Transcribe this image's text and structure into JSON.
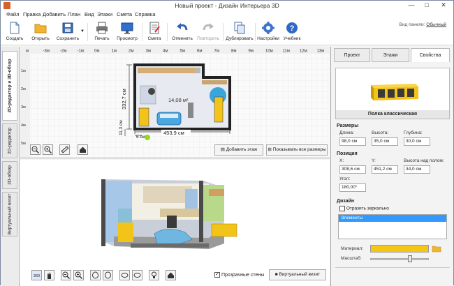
{
  "window": {
    "title": "Новый проект - Дизайн Интерьера 3D",
    "min": "—",
    "max": "□",
    "close": "✕"
  },
  "menu": [
    "Файл",
    "Правка",
    "Добавить",
    "План",
    "Вид",
    "Этажи",
    "Смета",
    "Справка"
  ],
  "toolbar": {
    "buttons": [
      {
        "label": "Создать",
        "icon": "new-file-icon"
      },
      {
        "label": "Открыть",
        "icon": "open-folder-icon"
      },
      {
        "label": "Сохранить",
        "icon": "save-icon"
      },
      {
        "label": "Печать",
        "icon": "printer-icon"
      },
      {
        "label": "Просмотр",
        "icon": "monitor-icon"
      },
      {
        "label": "Смета",
        "icon": "estimate-icon"
      },
      {
        "label": "Отменить",
        "icon": "undo-icon"
      },
      {
        "label": "Повторить",
        "icon": "redo-icon"
      },
      {
        "label": "Дублировать",
        "icon": "duplicate-icon"
      },
      {
        "label": "Настройки",
        "icon": "gear-icon"
      },
      {
        "label": "Учебник",
        "icon": "help-icon"
      }
    ],
    "panel_view_label": "Вид панели:",
    "panel_view_value": "Обычный"
  },
  "left_tabs": [
    "2D-редактор и 3D-обзор",
    "2D-редактор",
    "3D-обзор",
    "Виртуальный визит"
  ],
  "plan": {
    "ruler_labels": [
      "м",
      "-3м",
      "-2м",
      "-1м",
      "0м",
      "1м",
      "2м",
      "3м",
      "4м",
      "5м",
      "6м",
      "7м",
      "8м",
      "9м",
      "10м",
      "11м",
      "12м",
      "13м"
    ],
    "vruler_labels": [
      "1м",
      "2м",
      "3м",
      "4м",
      "5м"
    ],
    "dim_height": "332,7 см",
    "dim_width": "453,9 см",
    "dim_small_h": "11,3 см",
    "dim_small_w": "6 см",
    "area": "14,08 м²",
    "add_floor": "Добавить этаж",
    "show_all_sizes": "Показывать все размеры"
  },
  "view3d": {
    "transparent_walls": "Прозрачные стены",
    "transparent_checked": true,
    "virtual_visit": "Виртуальный визит"
  },
  "right": {
    "tabs": [
      "Проект",
      "Этажи",
      "Свойства"
    ],
    "active_tab": 2,
    "object_name": "Полка классическая",
    "sizes_title": "Размеры",
    "length_label": "Длина:",
    "length_value": "98,0 см",
    "height_label": "Высота:",
    "height_value": "35,0 см",
    "depth_label": "Глубина:",
    "depth_value": "30,0 см",
    "position_title": "Позиция",
    "x_label": "X:",
    "x_value": "308,6 см",
    "y_label": "Y:",
    "y_value": "451,2 см",
    "floor_height_label": "Высота над полом:",
    "floor_height_value": "34,0 см",
    "angle_label": "Угол:",
    "angle_value": "180,00°",
    "design_title": "Дизайн",
    "mirror_label": "Отразить зеркально",
    "elements_item": "Элементы",
    "material_label": "Материал:",
    "material_color": "#f5c518",
    "scale_label": "Масштаб:"
  },
  "colors": {
    "accent": "#3a7bd5",
    "selection": "#3399ff",
    "shelf_yellow": "#f5c518"
  }
}
